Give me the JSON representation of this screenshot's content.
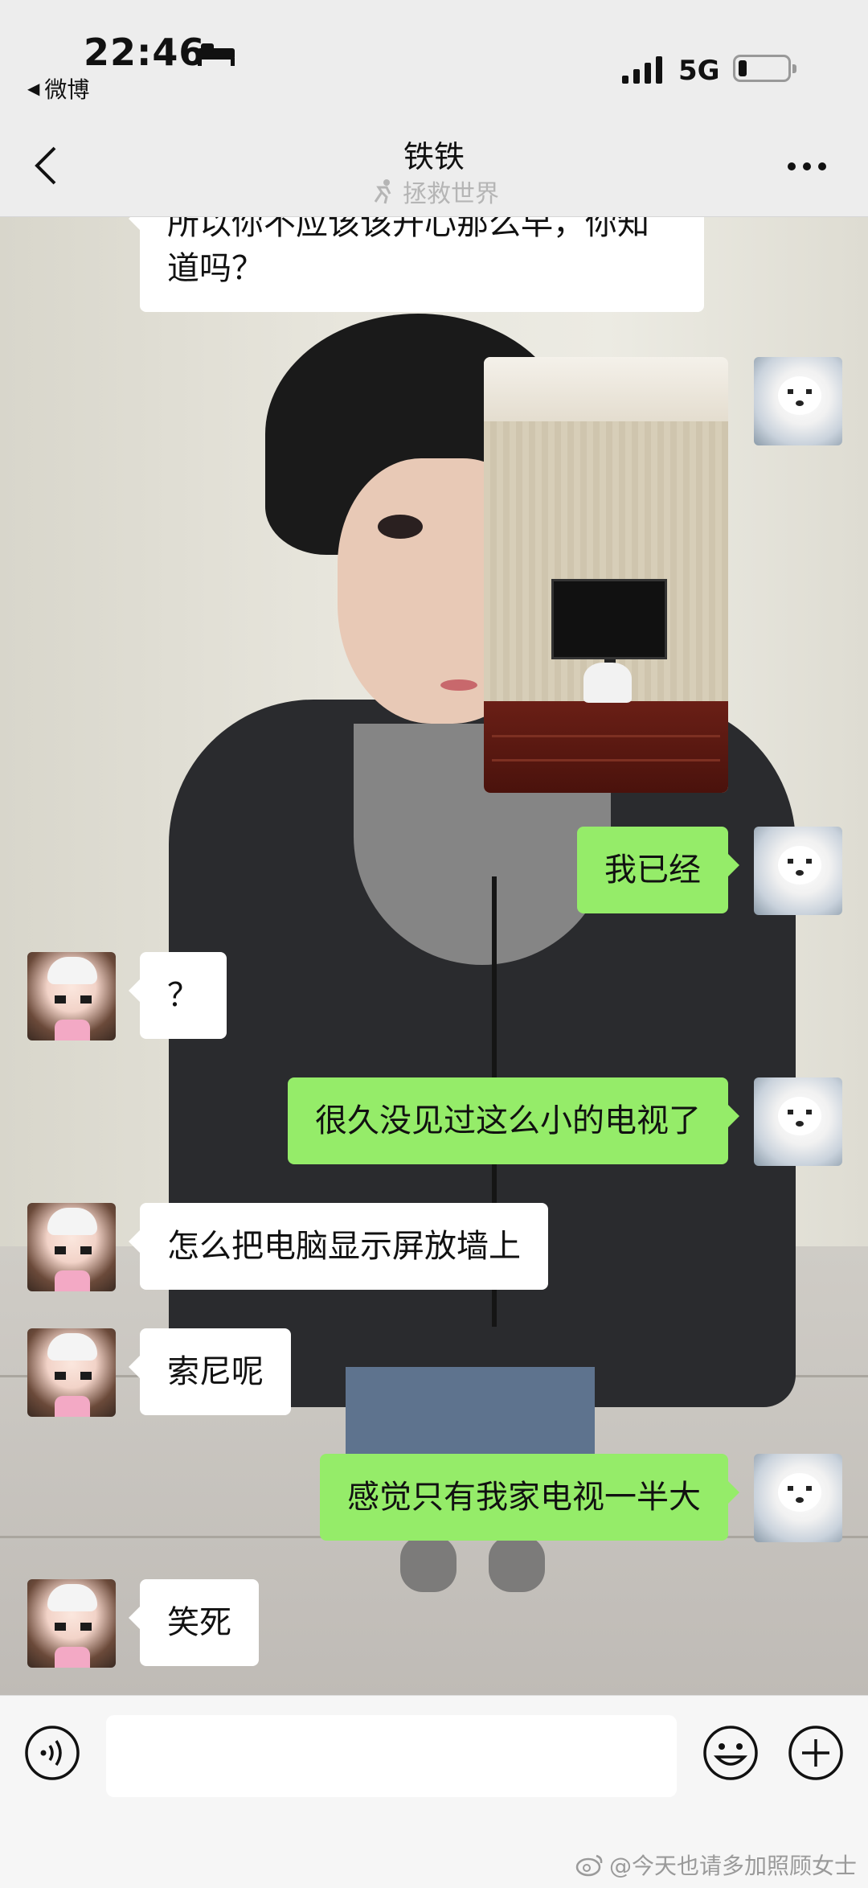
{
  "status_bar": {
    "time": "22:46",
    "back_app": "微博",
    "network": "5G"
  },
  "header": {
    "title": "铁铁",
    "status": "拯救世界"
  },
  "messages": [
    {
      "side": "left",
      "type": "text",
      "text": "所以你不应该该开心那么早，你知道吗？"
    },
    {
      "side": "right",
      "type": "image"
    },
    {
      "side": "right",
      "type": "text",
      "text": "我已经"
    },
    {
      "side": "left",
      "type": "text",
      "text": "？"
    },
    {
      "side": "right",
      "type": "text",
      "text": "很久没见过这么小的电视了"
    },
    {
      "side": "left",
      "type": "text",
      "text": "怎么把电脑显示屏放墙上"
    },
    {
      "side": "left",
      "type": "text",
      "text": "索尼呢"
    },
    {
      "side": "right",
      "type": "text",
      "text": "感觉只有我家电视一半大"
    },
    {
      "side": "left",
      "type": "text",
      "text": "笑死"
    }
  ],
  "input": {
    "value": "",
    "placeholder": ""
  },
  "watermark": "@今天也请多加照顾女士",
  "colors": {
    "self_bubble": "#95ec69",
    "other_bubble": "#ffffff",
    "bar_background": "#ededed"
  },
  "icons": [
    "back-arrow-icon",
    "more-icon",
    "voice-icon",
    "emoji-icon",
    "plus-icon",
    "signal-icon",
    "battery-icon",
    "bed-icon",
    "weibo-icon"
  ]
}
